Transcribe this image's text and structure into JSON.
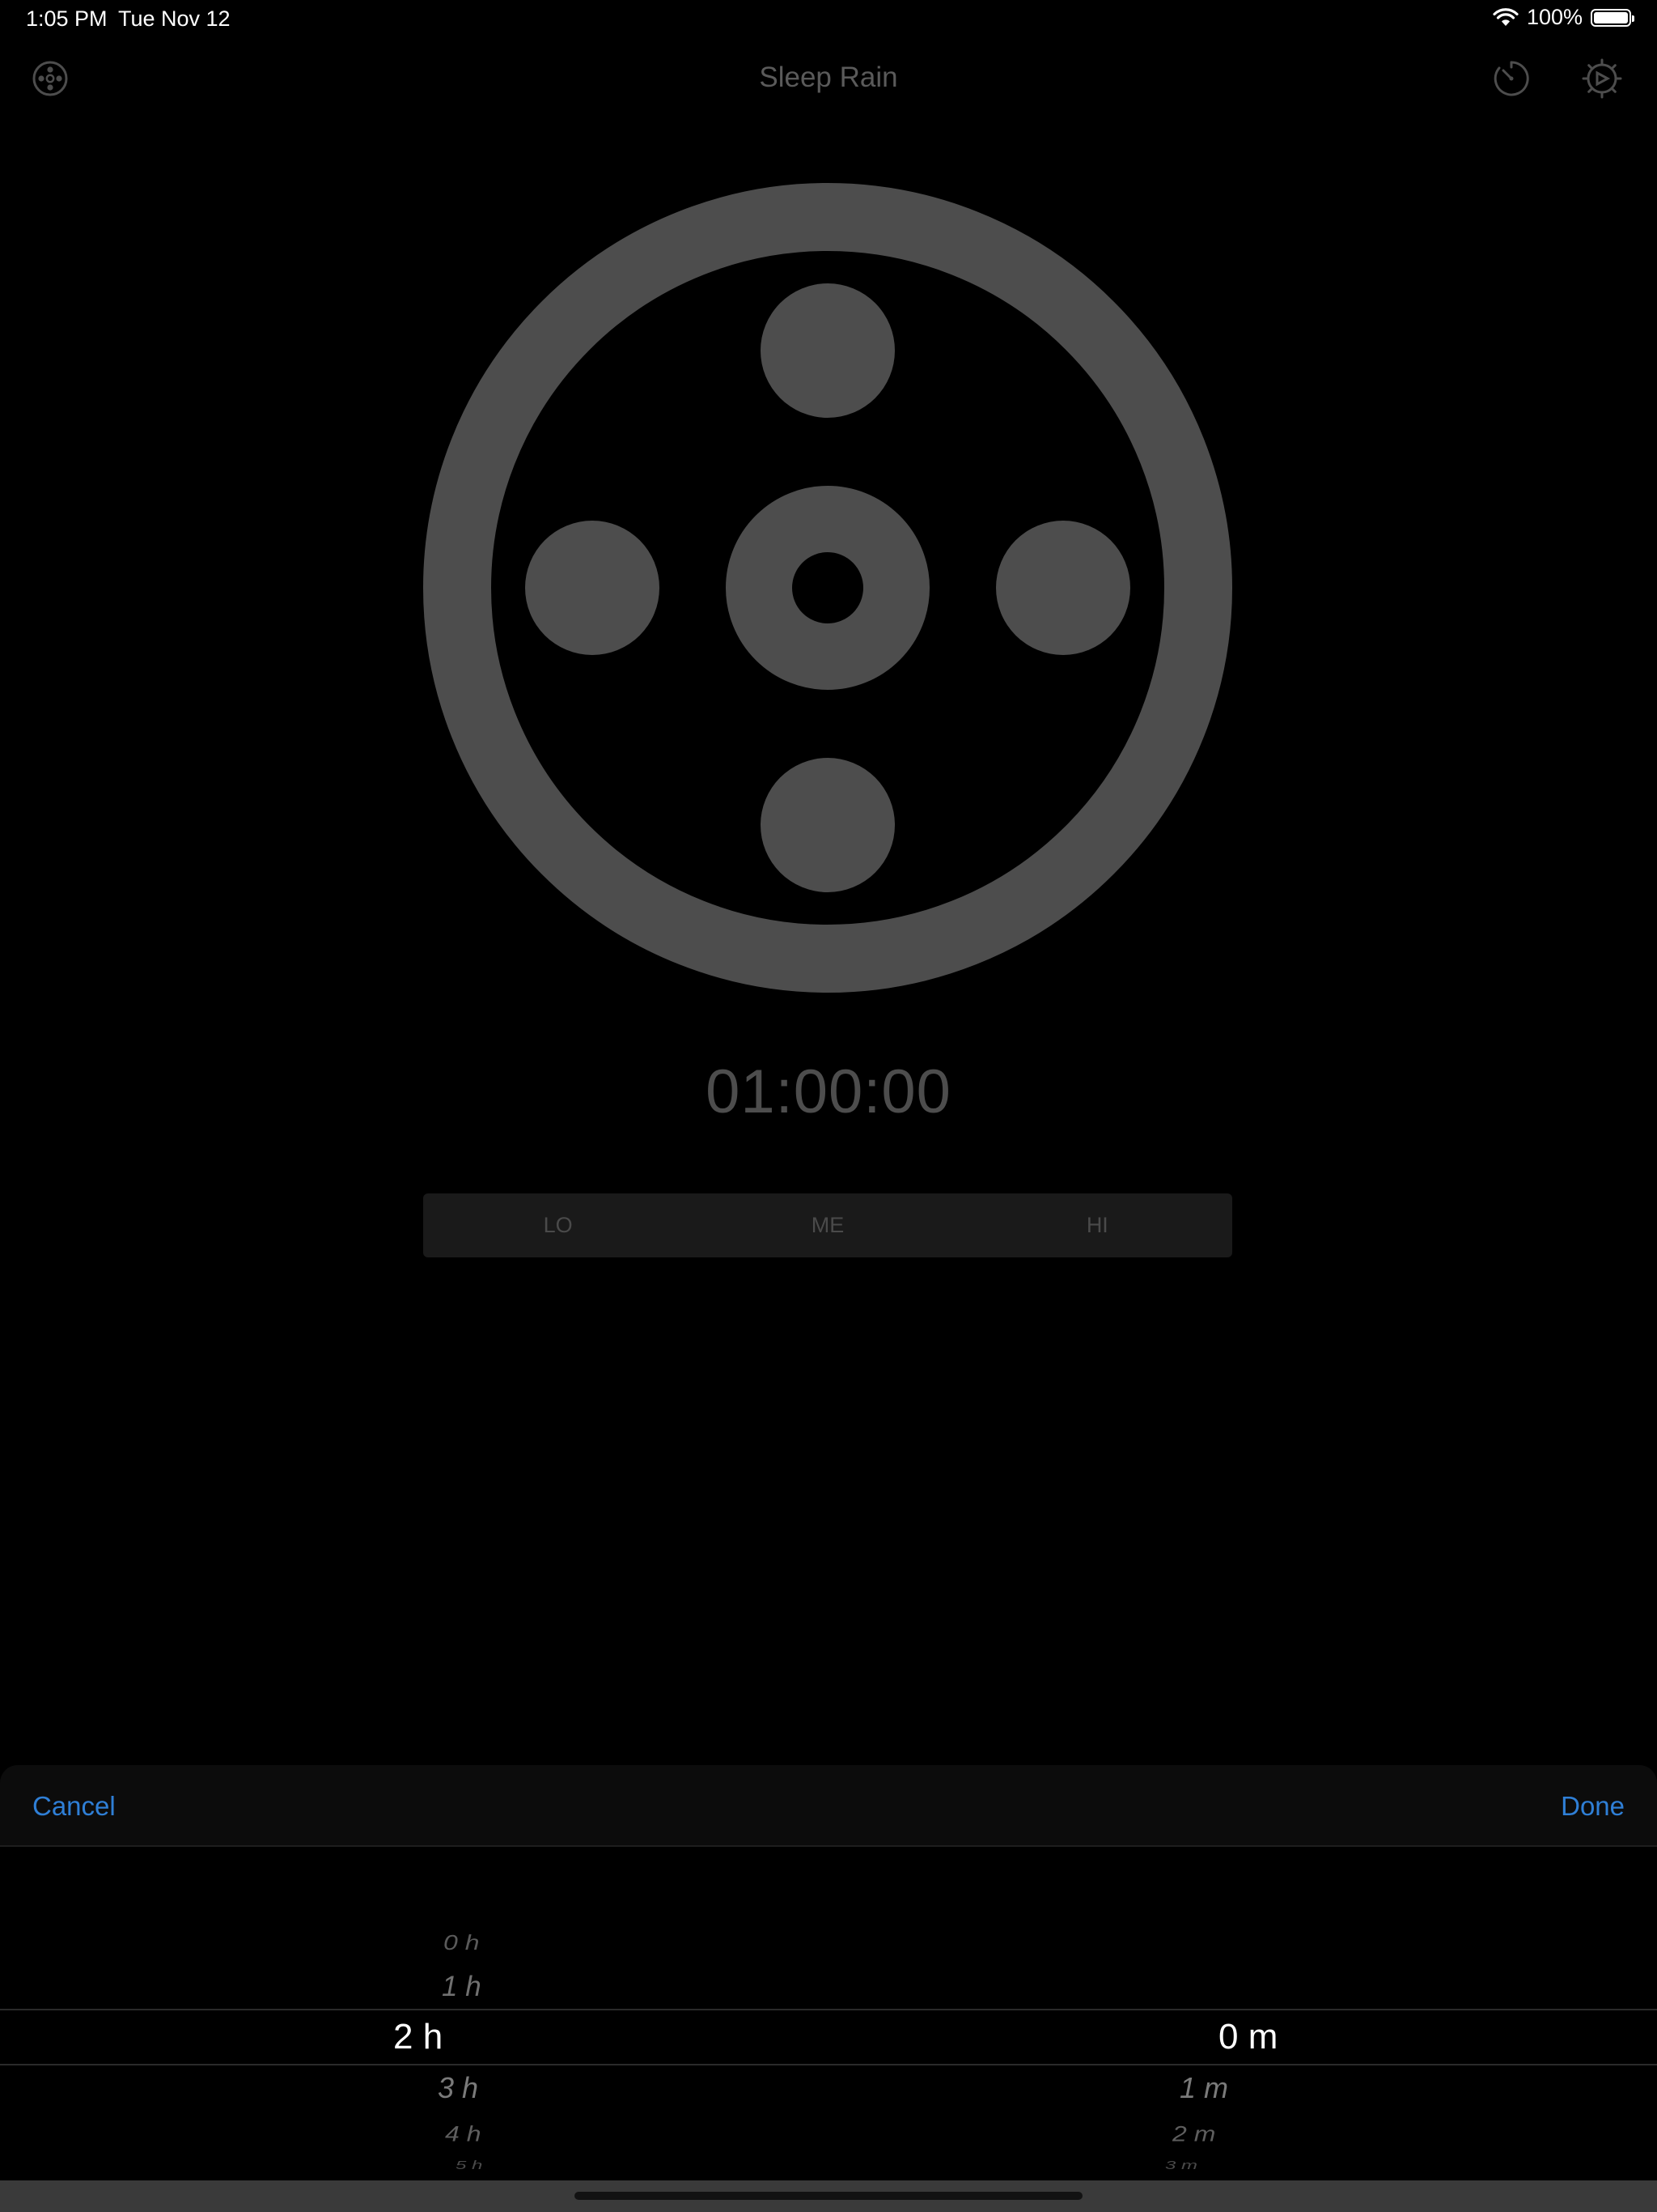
{
  "status": {
    "time": "1:05 PM",
    "date": "Tue Nov 12",
    "battery": "100%",
    "battery_level": 1.0
  },
  "nav": {
    "title": "Sleep Rain",
    "left_icon": "sound-mixer-icon",
    "timer_icon": "timer-icon",
    "settings_icon": "settings-gear-icon"
  },
  "dial": {
    "icon": "rain-dial-icon"
  },
  "timer": {
    "display": "01:00:00"
  },
  "intensity": {
    "options": [
      "LO",
      "ME",
      "HI"
    ]
  },
  "sheet": {
    "cancel": "Cancel",
    "done": "Done"
  },
  "picker": {
    "hours": [
      "0 h",
      "1 h",
      "2 h",
      "3 h",
      "4 h",
      "5 h"
    ],
    "hours_selected": "2 h",
    "minutes": [
      "0 m",
      "1 m",
      "2 m",
      "3 m"
    ],
    "minutes_selected": "0 m"
  },
  "colors": {
    "accent": "#2f7fd6",
    "dial": "#4d4d4d",
    "background": "#000000"
  }
}
